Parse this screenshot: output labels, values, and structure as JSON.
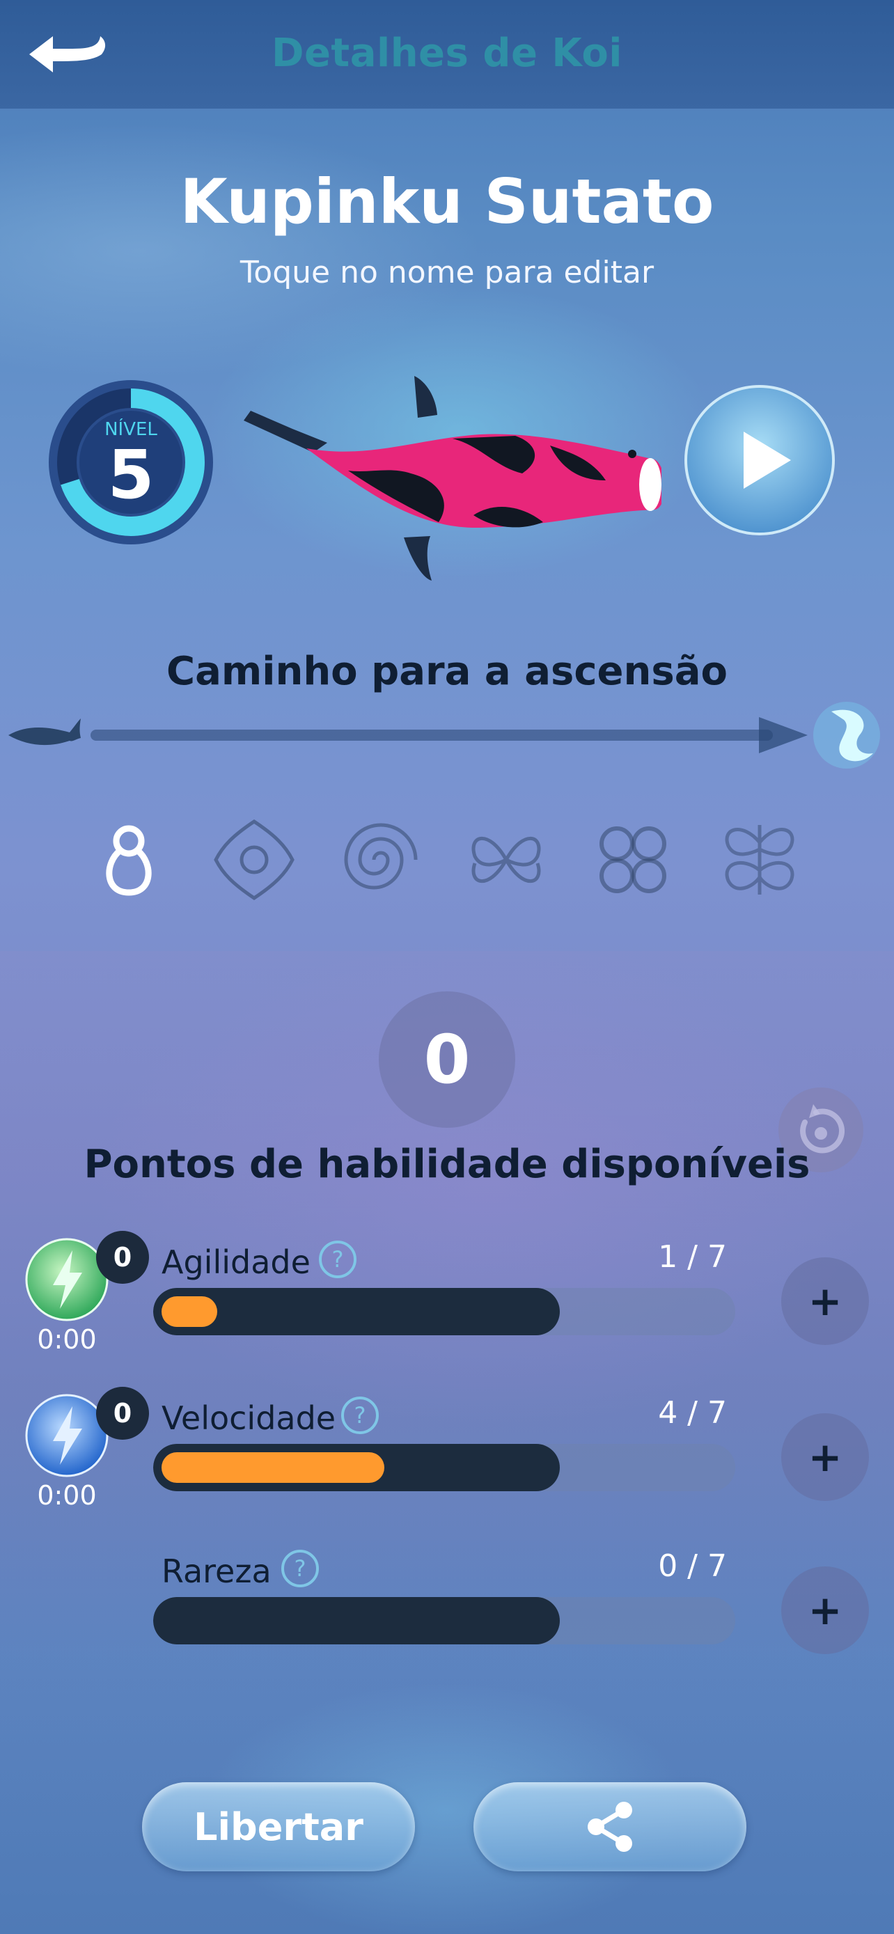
{
  "header": {
    "title": "Detalhes de Koi",
    "back_icon": "back-arrow-icon"
  },
  "koi": {
    "name": "Kupinku Sutato",
    "edit_hint": "Toque no nome para editar"
  },
  "level": {
    "label": "NÍVEL",
    "value": "5",
    "progress": 0.7
  },
  "ascension": {
    "title": "Caminho para a ascensão",
    "start_icon": "koi-silhouette-icon",
    "end_icon": "dragon-icon",
    "stages": [
      "stage-1-icon",
      "stage-2-icon",
      "stage-3-icon",
      "stage-4-icon",
      "stage-5-icon",
      "stage-6-icon"
    ],
    "active_stage": 0
  },
  "skills": {
    "available_points": "0",
    "available_label": "Pontos de habilidade disponíveis",
    "reset_icon": "reset-icon",
    "stats": [
      {
        "name": "Agilidade",
        "value": "1 / 7",
        "current": 1,
        "max": 7,
        "boost_count": "0",
        "boost_timer": "0:00",
        "boost_color": "#45c86a"
      },
      {
        "name": "Velocidade",
        "value": "4 / 7",
        "current": 4,
        "max": 7,
        "boost_count": "0",
        "boost_timer": "0:00",
        "boost_color": "#3a7fe0"
      },
      {
        "name": "Rareza",
        "value": "0 / 7",
        "current": 0,
        "max": 7
      }
    ],
    "plus_label": "+"
  },
  "actions": {
    "release_label": "Libertar",
    "share_icon": "share-icon"
  },
  "colors": {
    "accent_orange": "#ff9a2e",
    "bar_dark": "#1c2c3e",
    "level_ring": "#4fd6ee",
    "koi_pink": "#e8267a"
  }
}
